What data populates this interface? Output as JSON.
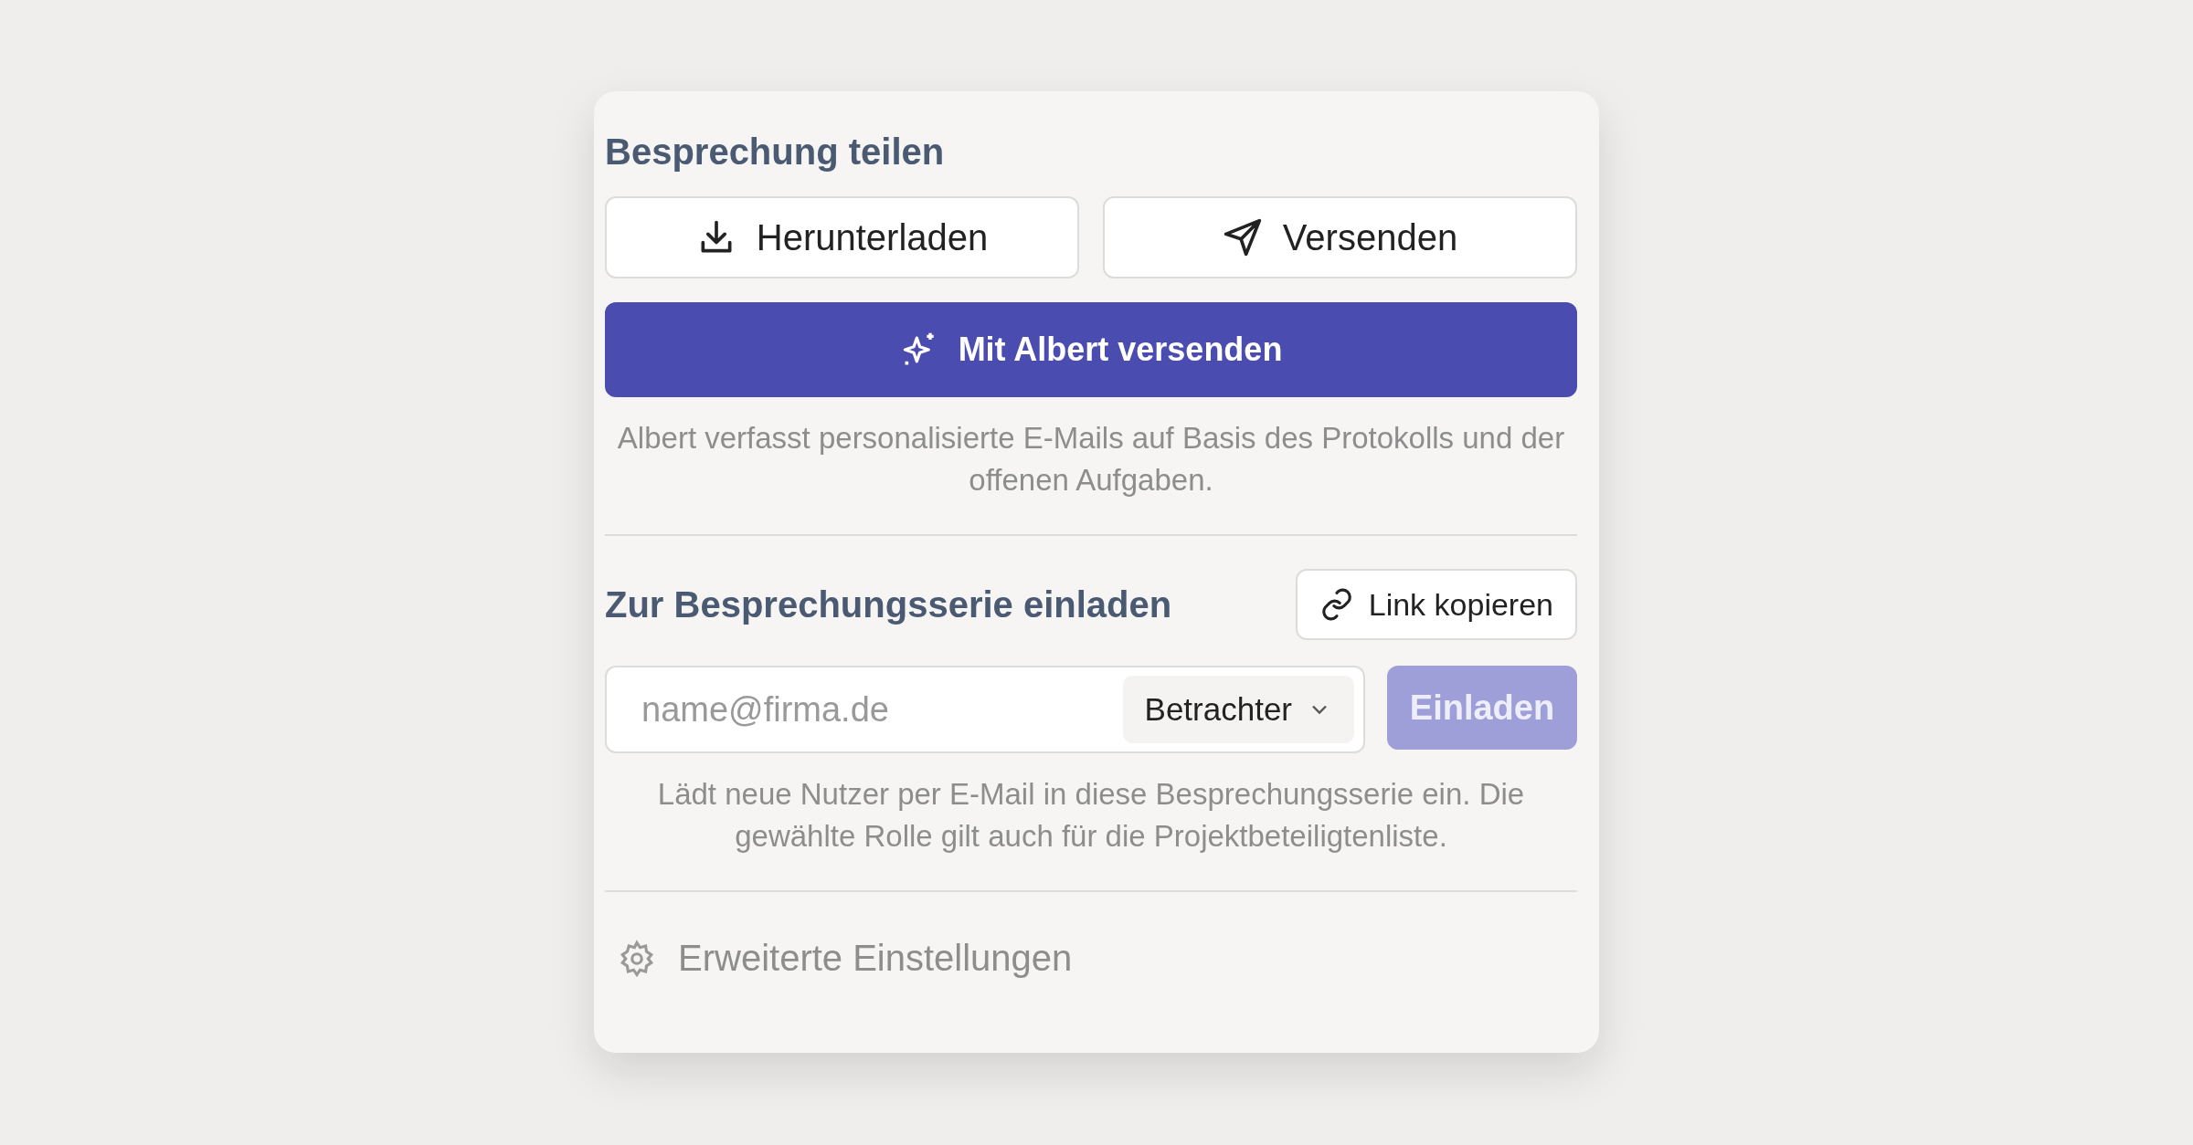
{
  "share": {
    "title": "Besprechung teilen",
    "buttons": [
      {
        "kind": "download",
        "label": "Herunterladen"
      },
      {
        "kind": "send",
        "label": "Versenden"
      }
    ],
    "ai_button": {
      "label": "Mit Albert versenden"
    },
    "hint": "Albert verfasst personalisierte E-Mails auf Basis des Protokolls und der offenen Aufgaben."
  },
  "invite": {
    "title": "Zur Besprechungsserie einladen",
    "copy_link": {
      "label": "Link kopieren"
    },
    "email": {
      "placeholder": "name@firma.de"
    },
    "role": {
      "value": "Betrachter"
    },
    "submit": {
      "label": "Einladen",
      "disabled": true
    },
    "hint": "Lädt neue Nutzer per E-Mail in diese Besprechungsserie ein. Die gewählte Rolle gilt auch für die Projektbeteiligtenliste."
  },
  "settings": {
    "label": "Erweiterte Einstellungen"
  }
}
